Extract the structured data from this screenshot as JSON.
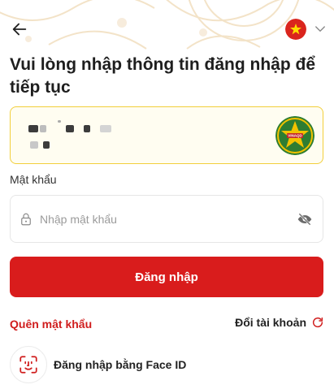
{
  "app": {
    "accent": "#d91c1c",
    "card_border": "#f2cf3b"
  },
  "header": {
    "back_icon": "arrow-left-icon",
    "language_flag": "vietnam-flag-icon"
  },
  "title": "Vui lòng nhập thông tin đăng nhập để tiếp tục",
  "account": {
    "masked": true,
    "badge_icon": "army-badge-icon",
    "badge_text": "VINAQD"
  },
  "password": {
    "label": "Mật khẩu",
    "placeholder": "Nhập mật khẩu",
    "value": ""
  },
  "actions": {
    "login_label": "Đăng nhập",
    "forgot_label": "Quên mật khẩu",
    "switch_label": "Đổi tài khoản",
    "faceid_label": "Đăng nhập bằng Face ID"
  }
}
